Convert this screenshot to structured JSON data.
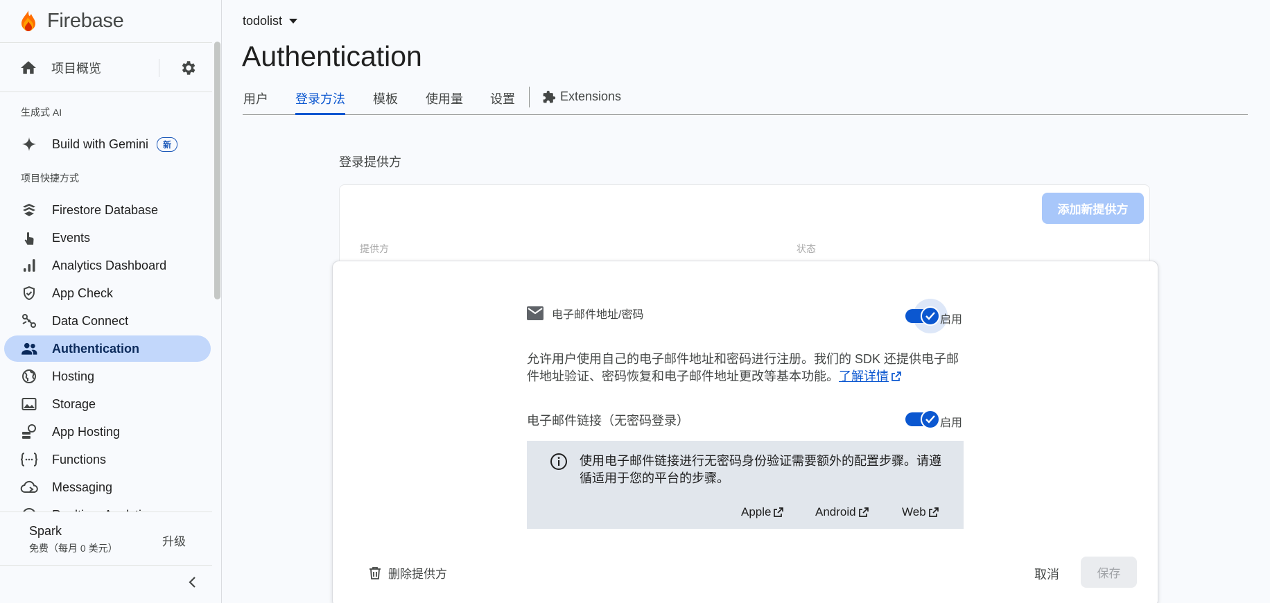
{
  "brand": {
    "name": "Firebase"
  },
  "sidebar": {
    "overview_label": "项目概览",
    "section_ai": "生成式 AI",
    "gemini": {
      "label": "Build with Gemini",
      "badge": "新"
    },
    "section_shortcuts": "项目快捷方式",
    "items": [
      {
        "label": "Firestore Database",
        "icon": "firestore-icon"
      },
      {
        "label": "Events",
        "icon": "touch-icon"
      },
      {
        "label": "Analytics Dashboard",
        "icon": "bar-chart-icon"
      },
      {
        "label": "App Check",
        "icon": "shield-check-icon"
      },
      {
        "label": "Data Connect",
        "icon": "data-connect-icon"
      },
      {
        "label": "Authentication",
        "icon": "people-icon",
        "active": true
      },
      {
        "label": "Hosting",
        "icon": "globe-icon"
      },
      {
        "label": "Storage",
        "icon": "image-icon"
      },
      {
        "label": "App Hosting",
        "icon": "app-hosting-icon"
      },
      {
        "label": "Functions",
        "icon": "functions-icon"
      },
      {
        "label": "Messaging",
        "icon": "cloud-messaging-icon"
      },
      {
        "label": "Realtime Analytics",
        "icon": "chart-icon"
      }
    ],
    "plan": {
      "name": "Spark",
      "desc": "免费（每月 0 美元）",
      "upgrade": "升级"
    }
  },
  "header": {
    "project": "todolist",
    "title": "Authentication",
    "tabs": [
      "用户",
      "登录方法",
      "模板",
      "使用量",
      "设置",
      "Extensions"
    ],
    "active_tab": "登录方法"
  },
  "providers": {
    "title": "登录提供方",
    "add_button": "添加新提供方",
    "col_provider": "提供方",
    "col_status": "状态"
  },
  "panel": {
    "email_provider_label": "电子邮件地址/密码",
    "email_enabled_label": "启用",
    "description": "允许用户使用自己的电子邮件地址和密码进行注册。我们的 SDK 还提供电子邮件地址验证、密码恢复和电子邮件地址更改等基本功能。",
    "learn_more": "了解详情",
    "email_link_label": "电子邮件链接（无密码登录）",
    "email_link_enabled_label": "启用",
    "info_text": "使用电子邮件链接进行无密码身份验证需要额外的配置步骤。请遵循适用于您的平台的步骤。",
    "platforms": [
      "Apple",
      "Android",
      "Web"
    ],
    "delete_label": "删除提供方",
    "cancel_label": "取消",
    "save_label": "保存"
  },
  "colors": {
    "accent": "#0b57d0",
    "active_nav": "#c2d7fb",
    "info_bg": "#e1e6ec"
  }
}
